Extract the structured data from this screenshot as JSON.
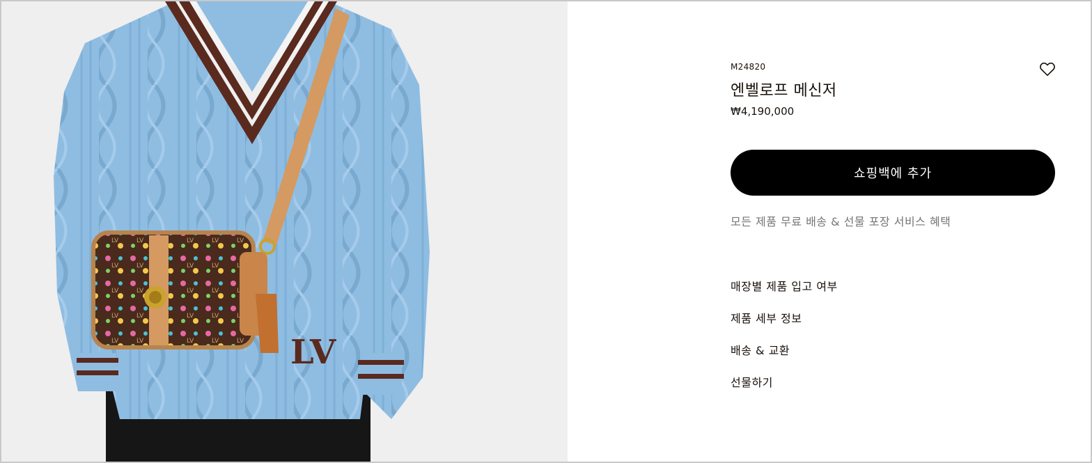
{
  "product": {
    "sku": "M24820",
    "name": "엔벨로프 메신저",
    "price": "₩4,190,000"
  },
  "actions": {
    "add_to_bag_label": "쇼핑백에 추가"
  },
  "perk_text": "모든 제품 무료 배송 & 선물 포장 서비스 혜택",
  "links": [
    {
      "label": "매장별 제품 입고 여부"
    },
    {
      "label": "제품 세부 정보"
    },
    {
      "label": "배송 & 교환"
    },
    {
      "label": "선물하기"
    }
  ],
  "colors": {
    "background": "#ffffff",
    "image_background": "#efefef",
    "sweater": "#8fbde2",
    "stripe": "#5a2a1f",
    "button": "#000000",
    "muted_text": "#767676"
  },
  "icons": {
    "wishlist": "heart-outline-icon"
  }
}
